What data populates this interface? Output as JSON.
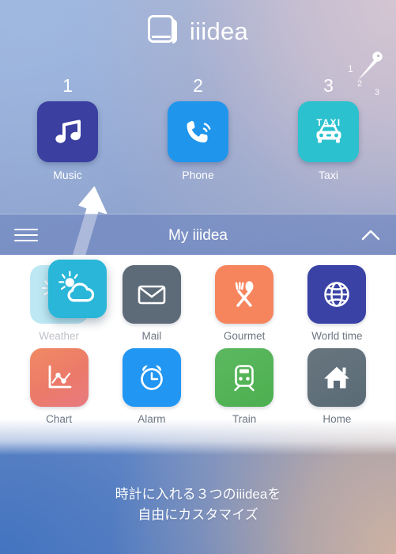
{
  "app": {
    "logo_text": "iiidea",
    "logo_icon": "book-icon"
  },
  "clock_indicator": {
    "icon": "clock-hand-icon",
    "marks": [
      "1",
      "2",
      "3"
    ]
  },
  "slots": {
    "items": [
      {
        "number": "1",
        "label": "Music",
        "icon": "music-note-icon",
        "color": "#3a3fa0"
      },
      {
        "number": "2",
        "label": "Phone",
        "icon": "phone-call-icon",
        "color": "#1f95ec"
      },
      {
        "number": "3",
        "label": "Taxi",
        "icon": "taxi-car-icon",
        "color": "#2bc1ce",
        "badge_text": "TAXI"
      }
    ]
  },
  "drag_hint": {
    "icon": "arrow-up-icon",
    "dragged_app": "Weather"
  },
  "bar": {
    "title": "My iiidea",
    "menu_icon": "hamburger-menu-icon",
    "collapse_icon": "chevron-up-icon"
  },
  "app_grid": {
    "apps": [
      {
        "label": "Weather",
        "icon": "sun-cloud-icon",
        "color": "#29b6d8",
        "state": "dragging"
      },
      {
        "label": "Mail",
        "icon": "envelope-icon",
        "color": "#5d6b78",
        "state": "normal"
      },
      {
        "label": "Gourmet",
        "icon": "fork-spoon-icon",
        "color": "#f6855e",
        "state": "normal"
      },
      {
        "label": "World time",
        "icon": "globe-icon",
        "color": "#3a43a5",
        "state": "normal"
      },
      {
        "label": "Chart",
        "icon": "line-chart-icon",
        "color": "#ef8064",
        "state": "normal"
      },
      {
        "label": "Alarm",
        "icon": "alarm-clock-icon",
        "color": "#2196f3",
        "state": "normal"
      },
      {
        "label": "Train",
        "icon": "train-icon",
        "color": "#4caf50",
        "state": "normal"
      },
      {
        "label": "Home",
        "icon": "house-icon",
        "color": "#5d6b78",
        "state": "normal"
      }
    ]
  },
  "caption": {
    "line1": "時計に入れる３つのiiideaを",
    "line2": "自由にカスタマイズ"
  },
  "theme": {
    "bg_top_left": "#9db6dd",
    "bg_top_right": "#d0c6d3",
    "bg_bottom_left": "#4a76c0",
    "bg_bottom_right": "#cdb3a4",
    "panel_bg": "#ffffff",
    "bar_bg": "#6880be",
    "label_color": "#6d7683"
  }
}
